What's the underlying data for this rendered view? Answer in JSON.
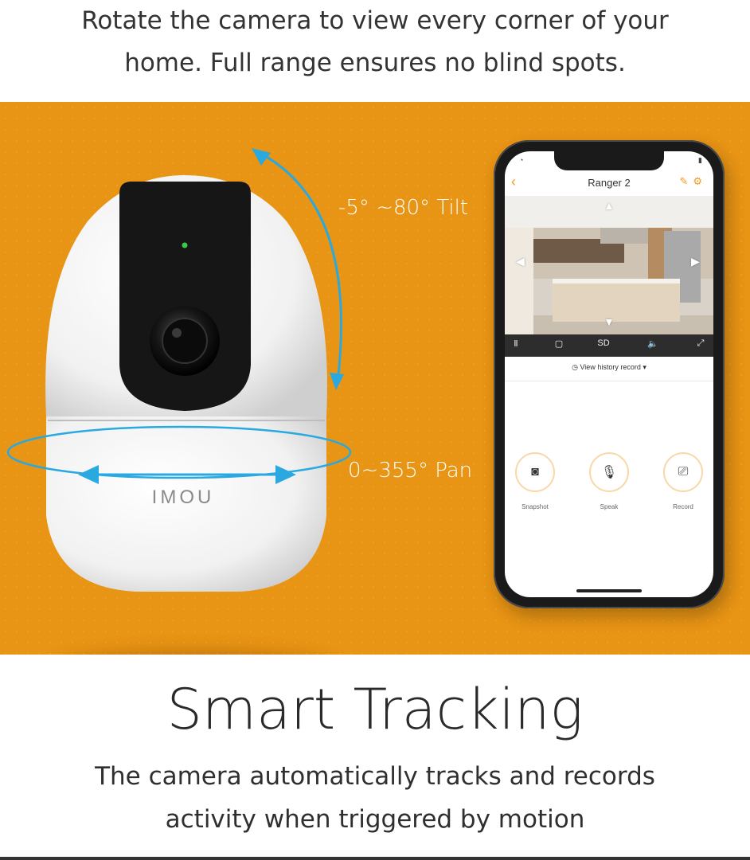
{
  "intro": {
    "line1": "Rotate the camera to view every corner of your",
    "line2": "home. Full range ensures no blind spots."
  },
  "banner": {
    "background_color": "#e89414",
    "arrow_color": "#2aa8e0",
    "tilt_label": "-5° ~80° Tilt",
    "pan_label": "0~355° Pan",
    "camera_brand": "IMOU"
  },
  "phone": {
    "app_title": "Ranger 2",
    "back_icon": "chevron-left-icon",
    "header_icons": [
      "edit-icon",
      "gear-icon"
    ],
    "toolbar_icons": [
      "pause-icon",
      "stop-icon",
      "sd-quality-icon",
      "mute-icon",
      "fullscreen-icon"
    ],
    "toolbar_sd": "SD",
    "history_link": "View history record",
    "actions": [
      {
        "icon": "camera-icon",
        "label": "Snapshot"
      },
      {
        "icon": "microphone-icon",
        "label": "Speak"
      },
      {
        "icon": "video-record-icon",
        "label": "Record"
      }
    ]
  },
  "feature": {
    "title": "Smart Tracking",
    "desc_line1": "The camera automatically tracks and records",
    "desc_line2": "activity when triggered by motion"
  }
}
